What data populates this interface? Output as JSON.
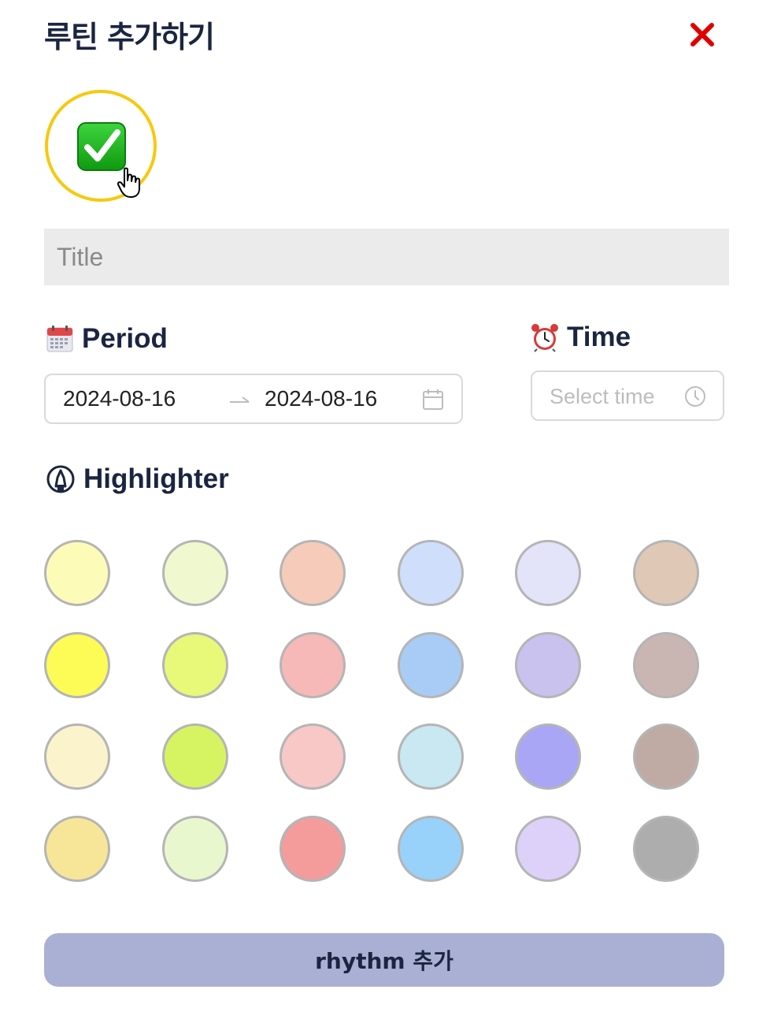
{
  "modal": {
    "title": "루틴 추가하기",
    "close_icon": "close-icon",
    "close_color": "#e00000"
  },
  "emoji_picker": {
    "selected_icon": "check-mark-button-icon",
    "ring_color": "#f6c90e"
  },
  "title_input": {
    "value": "",
    "placeholder": "Title"
  },
  "period": {
    "label": "Period",
    "icon": "calendar-emoji-icon",
    "start_date": "2024-08-16",
    "end_date": "2024-08-16",
    "separator_icon": "arrow-right-icon",
    "picker_icon": "calendar-icon"
  },
  "time": {
    "label": "Time",
    "icon": "alarm-clock-emoji-icon",
    "value": "",
    "placeholder": "Select time",
    "picker_icon": "clock-icon"
  },
  "highlighter": {
    "label": "Highlighter",
    "icon": "highlighter-icon",
    "colors": [
      [
        "#fdfbb8",
        "#f0f8cf",
        "#f6cbba",
        "#cfdffb",
        "#e3e3fa",
        "#dfc9b6"
      ],
      [
        "#fdfb56",
        "#e8f878",
        "#f7b8b8",
        "#a8ccf6",
        "#c9c2ef",
        "#c9b6b2"
      ],
      [
        "#fbf3cc",
        "#d6f461",
        "#f8c8c6",
        "#c9e8f1",
        "#a8a6f5",
        "#bfaba4"
      ],
      [
        "#f8e698",
        "#e9f7cf",
        "#f49c9c",
        "#98d2fa",
        "#ddd1fa",
        "#adadad"
      ]
    ]
  },
  "submit": {
    "label": "rhythm 추가",
    "bg_color": "#aab0d4"
  }
}
